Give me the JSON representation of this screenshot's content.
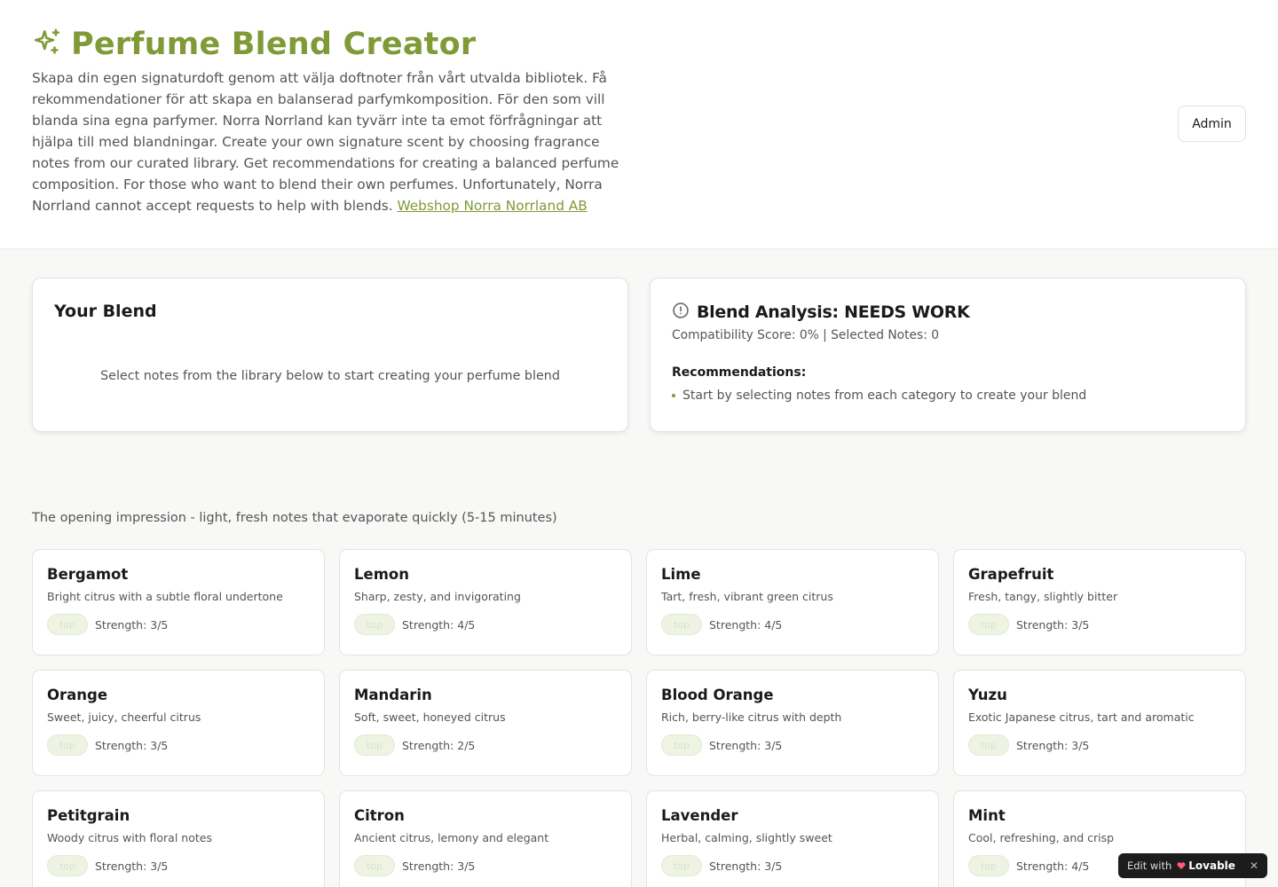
{
  "header": {
    "title": "Perfume Blend Creator",
    "intro": "Skapa din egen signaturdoft genom att välja doftnoter från vårt utvalda bibliotek. Få rekommendationer för att skapa en balanserad parfymkomposition. För den som vill blanda sina egna parfymer. Norra Norrland kan tyvärr inte ta emot förfrågningar att hjälpa till med blandningar. Create your own signature scent by choosing fragrance notes from our curated library. Get recommendations for creating a balanced perfume composition. For those who want to blend their own perfumes. Unfortunately, Norra Norrland cannot accept requests to help with blends.",
    "link_label": "Webshop Norra Norrland AB",
    "admin_label": "Admin",
    "accent_color": "#7f9a36"
  },
  "blend": {
    "title": "Your Blend",
    "empty_text": "Select notes from the library below to start creating your perfume blend"
  },
  "analysis": {
    "title": "Blend Analysis: NEEDS WORK",
    "score_line": "Compatibility Score: 0% | Selected Notes: 0",
    "recommendations_title": "Recommendations:",
    "recommendations": [
      "Start by selecting notes from each category to create your blend"
    ]
  },
  "section": {
    "description": "The opening impression - light, fresh notes that evaporate quickly (5-15 minutes)"
  },
  "notes": [
    {
      "name": "Bergamot",
      "desc": "Bright citrus with a subtle floral undertone",
      "tag": "top",
      "strength": "Strength: 3/5"
    },
    {
      "name": "Lemon",
      "desc": "Sharp, zesty, and invigorating",
      "tag": "top",
      "strength": "Strength: 4/5"
    },
    {
      "name": "Lime",
      "desc": "Tart, fresh, vibrant green citrus",
      "tag": "top",
      "strength": "Strength: 4/5"
    },
    {
      "name": "Grapefruit",
      "desc": "Fresh, tangy, slightly bitter",
      "tag": "top",
      "strength": "Strength: 3/5"
    },
    {
      "name": "Orange",
      "desc": "Sweet, juicy, cheerful citrus",
      "tag": "top",
      "strength": "Strength: 3/5"
    },
    {
      "name": "Mandarin",
      "desc": "Soft, sweet, honeyed citrus",
      "tag": "top",
      "strength": "Strength: 2/5"
    },
    {
      "name": "Blood Orange",
      "desc": "Rich, berry-like citrus with depth",
      "tag": "top",
      "strength": "Strength: 3/5"
    },
    {
      "name": "Yuzu",
      "desc": "Exotic Japanese citrus, tart and aromatic",
      "tag": "top",
      "strength": "Strength: 3/5"
    },
    {
      "name": "Petitgrain",
      "desc": "Woody citrus with floral notes",
      "tag": "top",
      "strength": "Strength: 3/5"
    },
    {
      "name": "Citron",
      "desc": "Ancient citrus, lemony and elegant",
      "tag": "top",
      "strength": "Strength: 3/5"
    },
    {
      "name": "Lavender",
      "desc": "Herbal, calming, slightly sweet",
      "tag": "top",
      "strength": "Strength: 3/5"
    },
    {
      "name": "Mint",
      "desc": "Cool, refreshing, and crisp",
      "tag": "top",
      "strength": "Strength: 4/5"
    }
  ],
  "badge": {
    "prefix": "Edit with",
    "brand": "Lovable",
    "close": "✕"
  }
}
